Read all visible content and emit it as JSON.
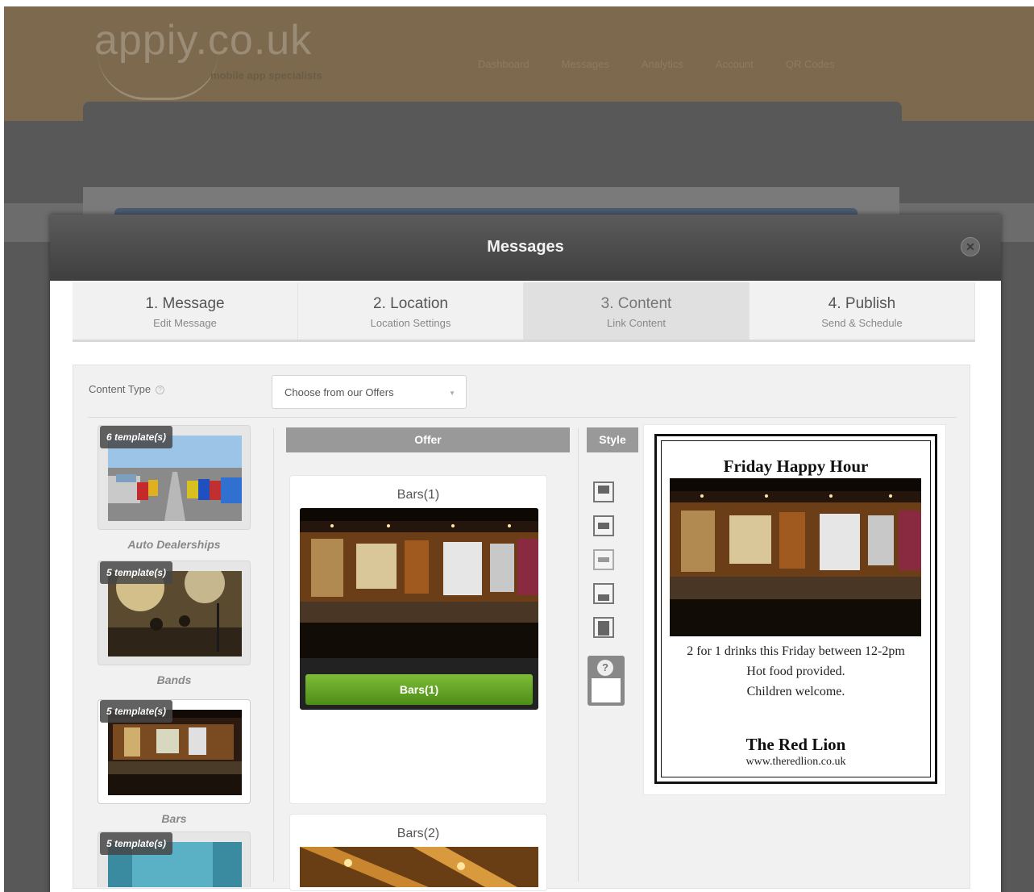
{
  "brand": {
    "logo_text": "appiy.co.uk",
    "tagline": "mobile app specialists"
  },
  "topnav": {
    "items": [
      "Dashboard",
      "Messages",
      "Analytics",
      "Account",
      "QR Codes"
    ]
  },
  "modal": {
    "title": "Messages",
    "close_icon": "close-icon"
  },
  "steps": [
    {
      "title": "1. Message",
      "subtitle": "Edit Message"
    },
    {
      "title": "2. Location",
      "subtitle": "Location Settings"
    },
    {
      "title": "3. Content",
      "subtitle": "Link Content",
      "active": true
    },
    {
      "title": "4. Publish",
      "subtitle": "Send & Schedule"
    }
  ],
  "content_type": {
    "label": "Content Type",
    "selected": "Choose from our Offers"
  },
  "categories": [
    {
      "badge": "6 template(s)",
      "label": "Auto Dealerships"
    },
    {
      "badge": "5 template(s)",
      "label": "Bands"
    },
    {
      "badge": "5 template(s)",
      "label": "Bars",
      "selected": true
    },
    {
      "badge": "5 template(s)",
      "label": ""
    }
  ],
  "offers": {
    "header": "Offer",
    "items": [
      {
        "title": "Bars(1)",
        "button": "Bars(1)"
      },
      {
        "title": "Bars(2)"
      }
    ]
  },
  "style": {
    "header": "Style",
    "help_icon": "question-icon"
  },
  "preview": {
    "title": "Friday Happy Hour",
    "lines": [
      "2 for 1 drinks this Friday between 12-2pm",
      "Hot food provided.",
      "Children welcome."
    ],
    "venue": "The Red Lion",
    "url": "www.theredlion.co.uk"
  },
  "colors": {
    "header_bg": "#7d6a4e",
    "modal_head": "#4a4a4a",
    "accent_green": "#5e9e22"
  }
}
